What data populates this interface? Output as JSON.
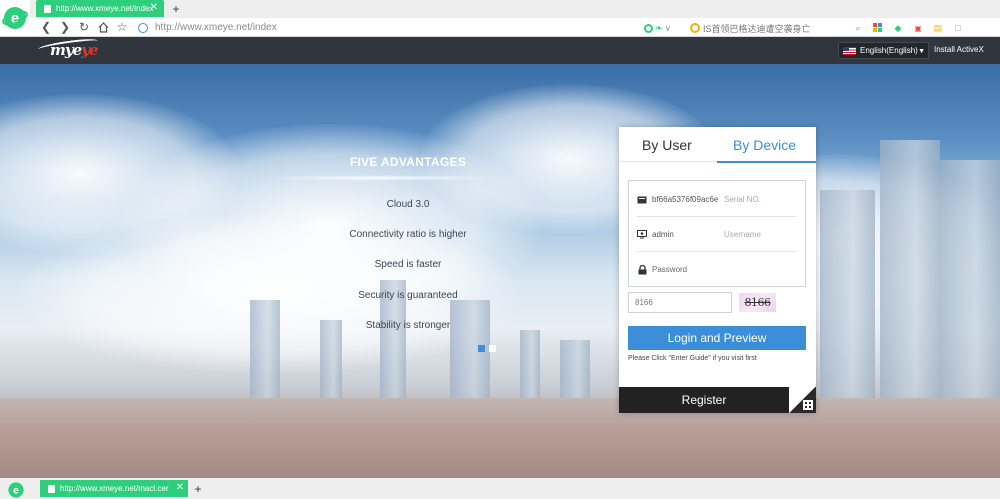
{
  "browser": {
    "tab_title": "http://www.xmeye.net/index",
    "tab_close": "✕",
    "new_tab": "+",
    "address": "http://www.xmeye.net/index",
    "news_text": "IS首领巴格达迪遭空袭身亡",
    "accent_color": "#2ecf7c",
    "logo_icon": "ie-e-icon"
  },
  "site": {
    "logo_text_main": "mye",
    "logo_text_accent": "ye",
    "language": "English(English)",
    "install_activex": "Install ActiveX",
    "header_color": "#31353e"
  },
  "advantages": {
    "title": "FIVE ADVANTAGES",
    "items": [
      "Cloud 3.0",
      "Connectivity ratio is higher",
      "Speed is faster",
      "Security is guaranteed",
      "Stability is stronger"
    ]
  },
  "login": {
    "tab_user": "By User",
    "tab_device": "By Device",
    "serial_value": "bf66a5376f09ac6e",
    "serial_placeholder": "Serial NO.",
    "username_value": "admin",
    "username_placeholder": "Username",
    "password_placeholder": "Password",
    "captcha_value": "8166",
    "captcha_image_text": "8166",
    "login_button": "Login and Preview",
    "enter_guide": "Please Click \"Enter Guide\" if you visit first",
    "register_button": "Register",
    "accent_color": "#3b8ed7"
  },
  "bottom_tab": {
    "title": "http://www.xmeye.net/macl.cer",
    "close": "✕",
    "new_tab": "+"
  }
}
